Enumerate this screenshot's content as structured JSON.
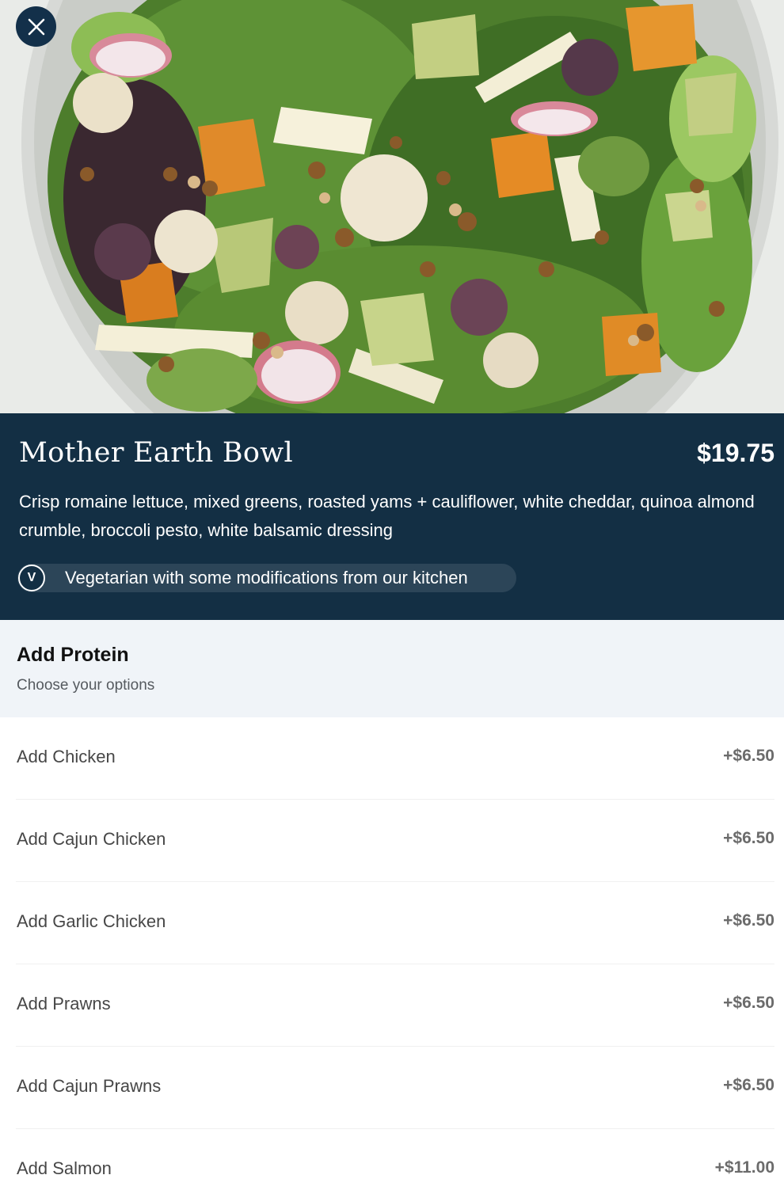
{
  "close_button": {
    "icon": "close-icon"
  },
  "item": {
    "name": "Mother Earth Bowl",
    "price": "$19.75",
    "description": "Crisp romaine lettuce, mixed greens, roasted yams + cauliflower, white cheddar, quinoa almond crumble, broccoli pesto, white balsamic dressing",
    "dietary": {
      "badge": "V",
      "text": "Vegetarian with some modifications from our kitchen"
    }
  },
  "section": {
    "title": "Add Protein",
    "subtitle": "Choose your options"
  },
  "options": [
    {
      "label": "Add Chicken",
      "price": "+$6.50"
    },
    {
      "label": "Add Cajun Chicken",
      "price": "+$6.50"
    },
    {
      "label": "Add Garlic Chicken",
      "price": "+$6.50"
    },
    {
      "label": "Add Prawns",
      "price": "+$6.50"
    },
    {
      "label": "Add Cajun Prawns",
      "price": "+$6.50"
    },
    {
      "label": "Add Salmon",
      "price": "+$11.00"
    }
  ],
  "colors": {
    "header_panel": "#132f44",
    "section_bg": "#f0f4f8",
    "close_button": "#13304a"
  }
}
